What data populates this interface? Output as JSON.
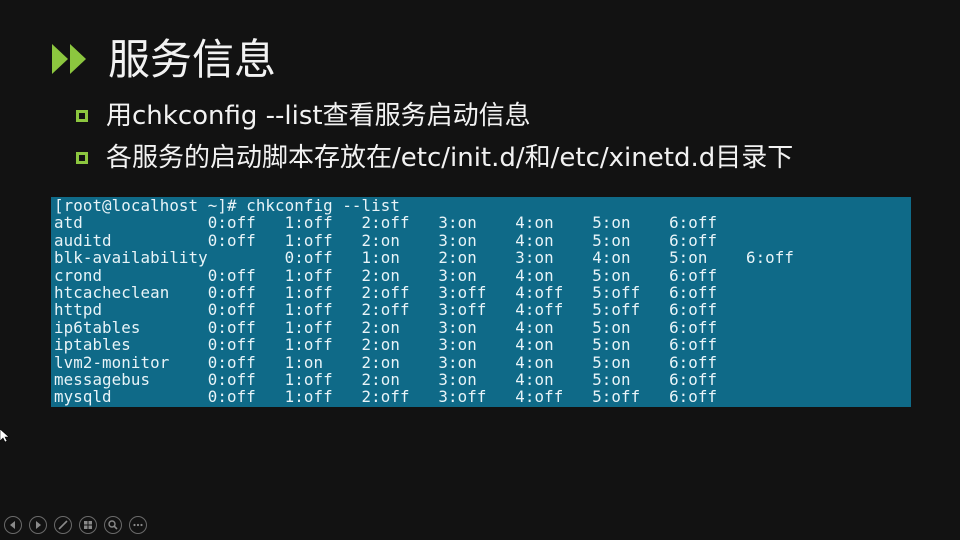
{
  "slide": {
    "title": "服务信息",
    "accent_color": "#8cc63f",
    "bullets": [
      {
        "text": "用chkconfig --list查看服务启动信息"
      },
      {
        "text": "各服务的启动脚本存放在/etc/init.d/和/etc/xinetd.d目录下"
      }
    ]
  },
  "terminal": {
    "background_color": "#0f6a88",
    "lines": [
      "[root@localhost ~]# chkconfig --list",
      "atd             0:off   1:off   2:off   3:on    4:on    5:on    6:off",
      "auditd          0:off   1:off   2:on    3:on    4:on    5:on    6:off",
      "blk-availability        0:off   1:on    2:on    3:on    4:on    5:on    6:off",
      "crond           0:off   1:off   2:on    3:on    4:on    5:on    6:off",
      "htcacheclean    0:off   1:off   2:off   3:off   4:off   5:off   6:off",
      "httpd           0:off   1:off   2:off   3:off   4:off   5:off   6:off",
      "ip6tables       0:off   1:off   2:on    3:on    4:on    5:on    6:off",
      "iptables        0:off   1:off   2:on    3:on    4:on    5:on    6:off",
      "lvm2-monitor    0:off   1:on    2:on    3:on    4:on    5:on    6:off",
      "messagebus      0:off   1:off   2:on    3:on    4:on    5:on    6:off",
      "mysqld          0:off   1:off   2:off   3:off   4:off   5:off   6:off"
    ]
  },
  "toolbar": {
    "buttons": [
      {
        "icon": "previous-icon"
      },
      {
        "icon": "next-icon"
      },
      {
        "icon": "pen-icon"
      },
      {
        "icon": "slides-icon"
      },
      {
        "icon": "zoom-icon"
      },
      {
        "icon": "more-icon"
      }
    ]
  }
}
